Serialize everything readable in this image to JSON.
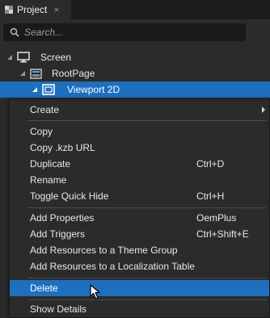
{
  "panel": {
    "tab_label": "Project",
    "tab_close": "×"
  },
  "search": {
    "placeholder": "Search..."
  },
  "tree": {
    "screen_label": "Screen",
    "rootpage_label": "RootPage",
    "viewport_label": "Viewport 2D"
  },
  "context_menu": {
    "create": "Create",
    "copy": "Copy",
    "copy_kzb_url": "Copy .kzb URL",
    "duplicate": "Duplicate",
    "duplicate_shortcut": "Ctrl+D",
    "rename": "Rename",
    "toggle_quick_hide": "Toggle Quick Hide",
    "toggle_quick_hide_shortcut": "Ctrl+H",
    "add_properties": "Add Properties",
    "add_properties_shortcut": "OemPlus",
    "add_triggers": "Add Triggers",
    "add_triggers_shortcut": "Ctrl+Shift+E",
    "add_resources_theme": "Add Resources to a Theme Group",
    "add_resources_localization": "Add Resources to a Localization Table",
    "delete": "Delete",
    "show_details": "Show Details"
  },
  "colors": {
    "selection": "#1e6fbe",
    "background": "#2b2b2b",
    "search_bg": "#1a1a1a"
  }
}
